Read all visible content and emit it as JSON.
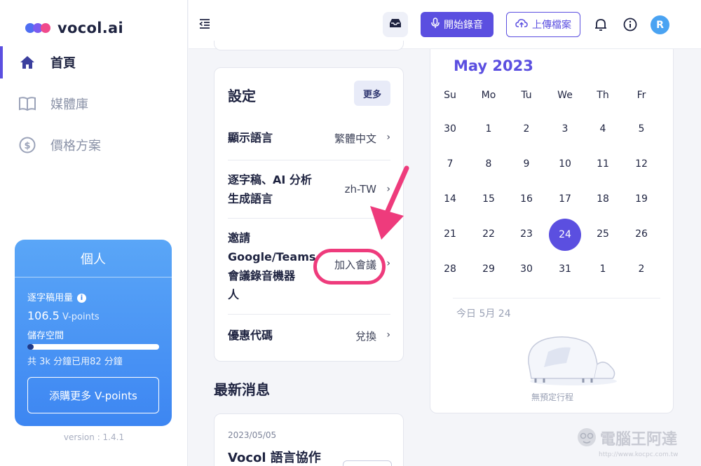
{
  "app": {
    "logo_text": "vocol.ai",
    "version": "version : 1.4.1"
  },
  "sidebar": {
    "items": [
      {
        "label": "首頁",
        "icon": "home-icon",
        "active": true
      },
      {
        "label": "媒體庫",
        "icon": "book-icon",
        "active": false
      },
      {
        "label": "價格方案",
        "icon": "dollar-icon",
        "active": false
      }
    ]
  },
  "plan": {
    "title": "個人",
    "usage_label": "逐字稿用量",
    "points_value": "106.5",
    "points_unit": "V-points",
    "storage_label": "儲存空間",
    "storage_progress": 0.05,
    "storage_detail": "共 3k 分鐘已用82 分鐘",
    "buy_label": "添購更多 V-points"
  },
  "topbar": {
    "record_label": "開始錄音",
    "upload_label": "上傳檔案",
    "avatar_initial": "R"
  },
  "settings": {
    "title": "設定",
    "more_label": "更多",
    "rows": [
      {
        "label_lines": [
          "顯示語言"
        ],
        "value": "繁體中文"
      },
      {
        "label_lines": [
          "逐字稿、AI 分析",
          "生成語言"
        ],
        "value": "zh-TW"
      },
      {
        "label_lines": [
          "邀請",
          "Google/Teams",
          "會議錄音機器",
          "人"
        ],
        "value": "加入會議"
      },
      {
        "label_lines": [
          "優惠代碼"
        ],
        "value": "兌換"
      }
    ]
  },
  "news": {
    "title": "最新消息",
    "date": "2023/05/05",
    "headline": "Vocol 語言協作"
  },
  "calendar": {
    "month": "May 2023",
    "weekdays": [
      "Su",
      "Mo",
      "Tu",
      "We",
      "Th",
      "Fr"
    ],
    "weeks": [
      [
        "30",
        "1",
        "2",
        "3",
        "4",
        "5"
      ],
      [
        "7",
        "8",
        "9",
        "10",
        "11",
        "12"
      ],
      [
        "14",
        "15",
        "16",
        "17",
        "18",
        "19"
      ],
      [
        "21",
        "22",
        "23",
        "24",
        "25",
        "26"
      ],
      [
        "28",
        "29",
        "30",
        "31",
        "1",
        "2"
      ]
    ],
    "selected_day": "24",
    "today_label": "今日 5月 24",
    "empty_label": "無預定行程"
  },
  "watermark": {
    "text": "電腦王阿達",
    "url": "http://www.kocpc.com.tw"
  },
  "colors": {
    "brand": "#5b4fe0",
    "highlight": "#ee3b7c",
    "plan_card": "#4a95f4"
  }
}
